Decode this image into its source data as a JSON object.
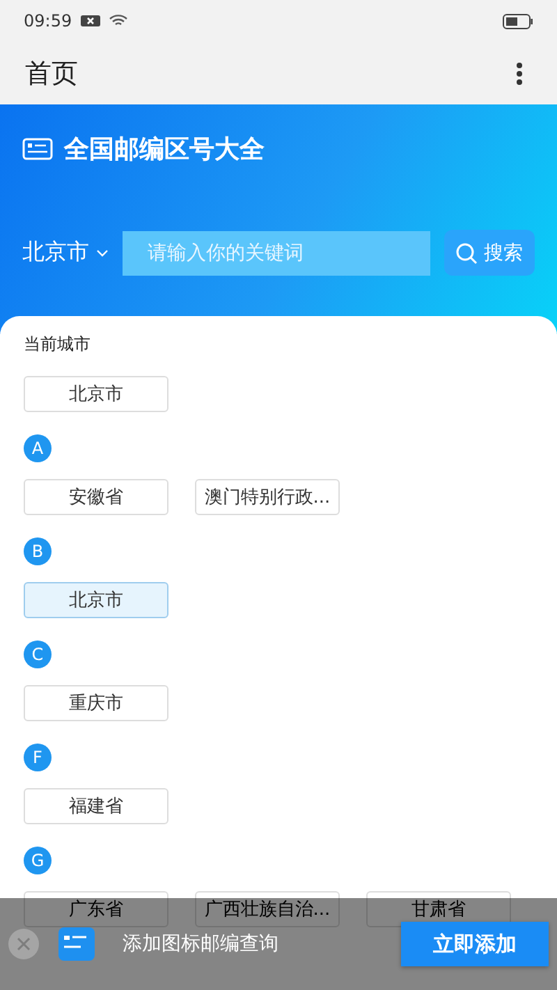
{
  "status_bar": {
    "time": "09:59"
  },
  "app_bar": {
    "title": "首页"
  },
  "header": {
    "title": "全国邮编区号大全",
    "city": "北京市",
    "search": {
      "placeholder": "请输入你的关键词",
      "button": "搜索"
    }
  },
  "current_city": {
    "label": "当前城市",
    "city": "北京市"
  },
  "groups": [
    {
      "letter": "A",
      "cities": [
        {
          "name": "安徽省",
          "selected": false
        },
        {
          "name": "澳门特别行政...",
          "selected": false
        }
      ]
    },
    {
      "letter": "B",
      "cities": [
        {
          "name": "北京市",
          "selected": true
        }
      ]
    },
    {
      "letter": "C",
      "cities": [
        {
          "name": "重庆市",
          "selected": false
        }
      ]
    },
    {
      "letter": "F",
      "cities": [
        {
          "name": "福建省",
          "selected": false
        }
      ]
    },
    {
      "letter": "G",
      "cities": [
        {
          "name": "广东省",
          "selected": false
        },
        {
          "name": "广西壮族自治...",
          "selected": false
        },
        {
          "name": "甘肃省",
          "selected": false
        }
      ]
    }
  ],
  "banner": {
    "text": "添加图标邮编查询",
    "button": "立即添加"
  }
}
